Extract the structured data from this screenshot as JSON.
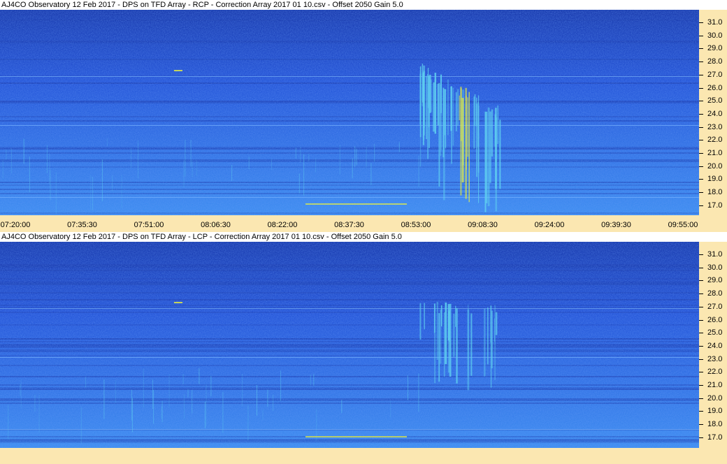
{
  "panels": [
    {
      "title": "AJ4CO Observatory 12 Feb 2017  -  DPS on TFD Array  -  RCP  -  Correction Array 2017 01 10.csv  -  Offset 2050  Gain 5.0",
      "polarization": "RCP"
    },
    {
      "title": "AJ4CO Observatory 12 Feb 2017  -  DPS on TFD Array  -  LCP  -  Correction Array 2017 01 10.csv  -  Offset 2050  Gain 5.0",
      "polarization": "LCP"
    }
  ],
  "frequency_labels": [
    "31.0",
    "30.0",
    "29.0",
    "28.0",
    "27.0",
    "26.0",
    "25.0",
    "24.0",
    "23.0",
    "22.0",
    "21.0",
    "20.0",
    "19.0",
    "18.0",
    "17.0"
  ],
  "time_labels": [
    "07:20:00",
    "07:35:30",
    "07:51:00",
    "08:06:30",
    "08:22:00",
    "08:37:30",
    "08:53:00",
    "09:08:30",
    "09:24:00",
    "09:39:30",
    "09:55:00"
  ],
  "colors": {
    "background": "#1f4fd6",
    "dark_band": "#1232a8",
    "light_band": "#3a8cf0",
    "burst_low": "#5fd0f0",
    "burst_high": "#e8f040",
    "axis_bg": "#fbe7b1"
  }
}
